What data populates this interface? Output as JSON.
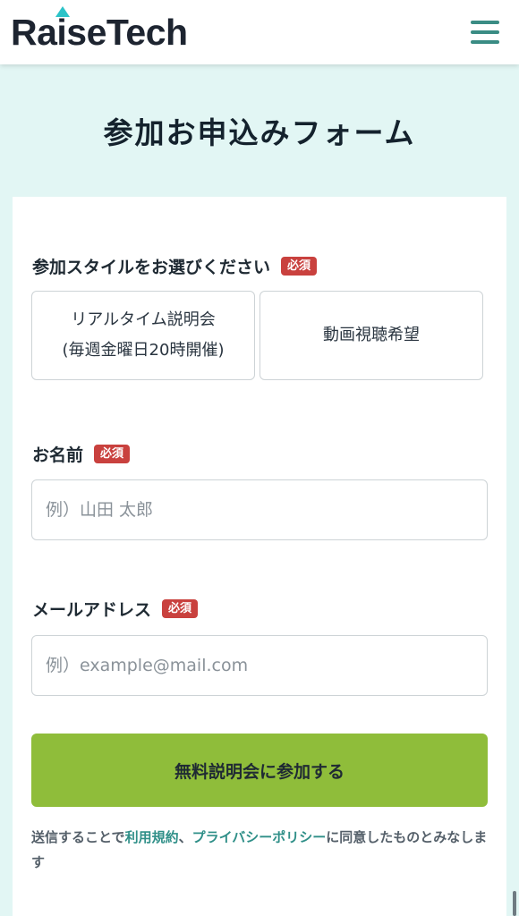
{
  "header": {
    "logo": "RaiseTech",
    "menu_icon": "hamburger-menu-icon",
    "logo_accent_color": "#2cc3c8",
    "menu_color": "#3a8c84"
  },
  "page": {
    "title": "参加お申込みフォーム",
    "background_color": "#e2f6f4"
  },
  "form": {
    "style_label": "参加スタイルをお選びください",
    "required_badge": "必須",
    "style_options": [
      {
        "line1": "リアルタイム説明会",
        "line2": "(毎週金曜日20時開催)"
      },
      {
        "line1": "動画視聴希望"
      }
    ],
    "name_label": "お名前",
    "name_placeholder": "例）山田 太郎",
    "email_label": "メールアドレス",
    "email_placeholder": "例）example@mail.com",
    "submit_label": "無料説明会に参加する",
    "submit_color": "#8fbd3a",
    "badge_color": "#c9413e",
    "agreement": {
      "prefix": "送信することで",
      "terms_link": "利用規約",
      "separator": "、",
      "privacy_link": "プライバシーポリシー",
      "suffix": "に同意したものとみなします",
      "link_color": "#2f8f88"
    }
  }
}
